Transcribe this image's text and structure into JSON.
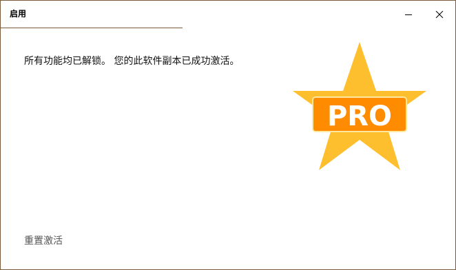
{
  "window": {
    "title": "启用"
  },
  "main": {
    "message": "所有功能均已解锁。 您的此软件副本已成功激活。",
    "badge_text": "PRO"
  },
  "footer": {
    "reset_label": "重置激活"
  },
  "icons": {
    "minimize": "minimize-icon",
    "close": "close-icon",
    "badge": "pro-star-icon"
  },
  "colors": {
    "star": "#FDBF2D",
    "badge_bg": "#FF8C00",
    "border": "#7A5A3A"
  }
}
